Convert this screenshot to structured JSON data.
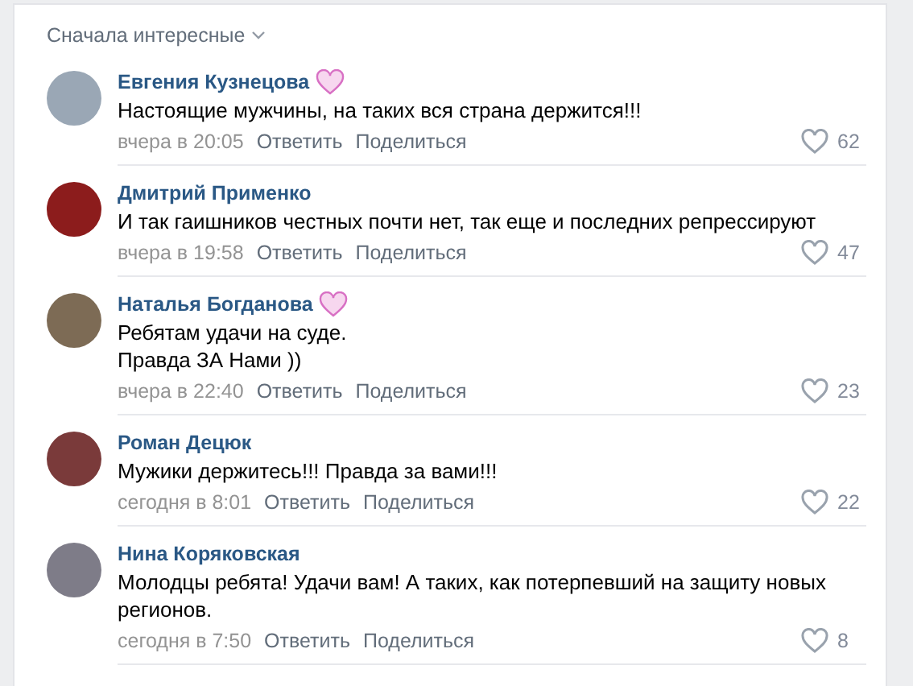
{
  "sort": {
    "label": "Сначала интересные"
  },
  "comments": [
    {
      "author": "Евгения Кузнецова",
      "sticker": true,
      "lines": [
        "Настоящие мужчины, на таких вся страна держится!!!"
      ],
      "time": "вчера в 20:05",
      "reply": "Ответить",
      "share": "Поделиться",
      "likes": "62"
    },
    {
      "author": "Дмитрий Применко",
      "sticker": false,
      "lines": [
        "И так гаишников честных почти нет, так еще и последних репрессируют"
      ],
      "time": "вчера в 19:58",
      "reply": "Ответить",
      "share": "Поделиться",
      "likes": "47"
    },
    {
      "author": "Наталья Богданова",
      "sticker": true,
      "lines": [
        "Ребятам удачи на суде.",
        "Правда ЗА Нами ))"
      ],
      "time": "вчера в 22:40",
      "reply": "Ответить",
      "share": "Поделиться",
      "likes": "23"
    },
    {
      "author": "Роман Децюк",
      "sticker": false,
      "lines": [
        "Мужики держитесь!!! Правда за вами!!!"
      ],
      "time": "сегодня в 8:01",
      "reply": "Ответить",
      "share": "Поделиться",
      "likes": "22"
    },
    {
      "author": "Нина Коряковская",
      "sticker": false,
      "lines": [
        "Молодцы ребята! Удачи вам! А таких, как потерпевший на защиту новых регионов."
      ],
      "time": "сегодня в 7:50",
      "reply": "Ответить",
      "share": "Поделиться",
      "likes": "8"
    }
  ]
}
